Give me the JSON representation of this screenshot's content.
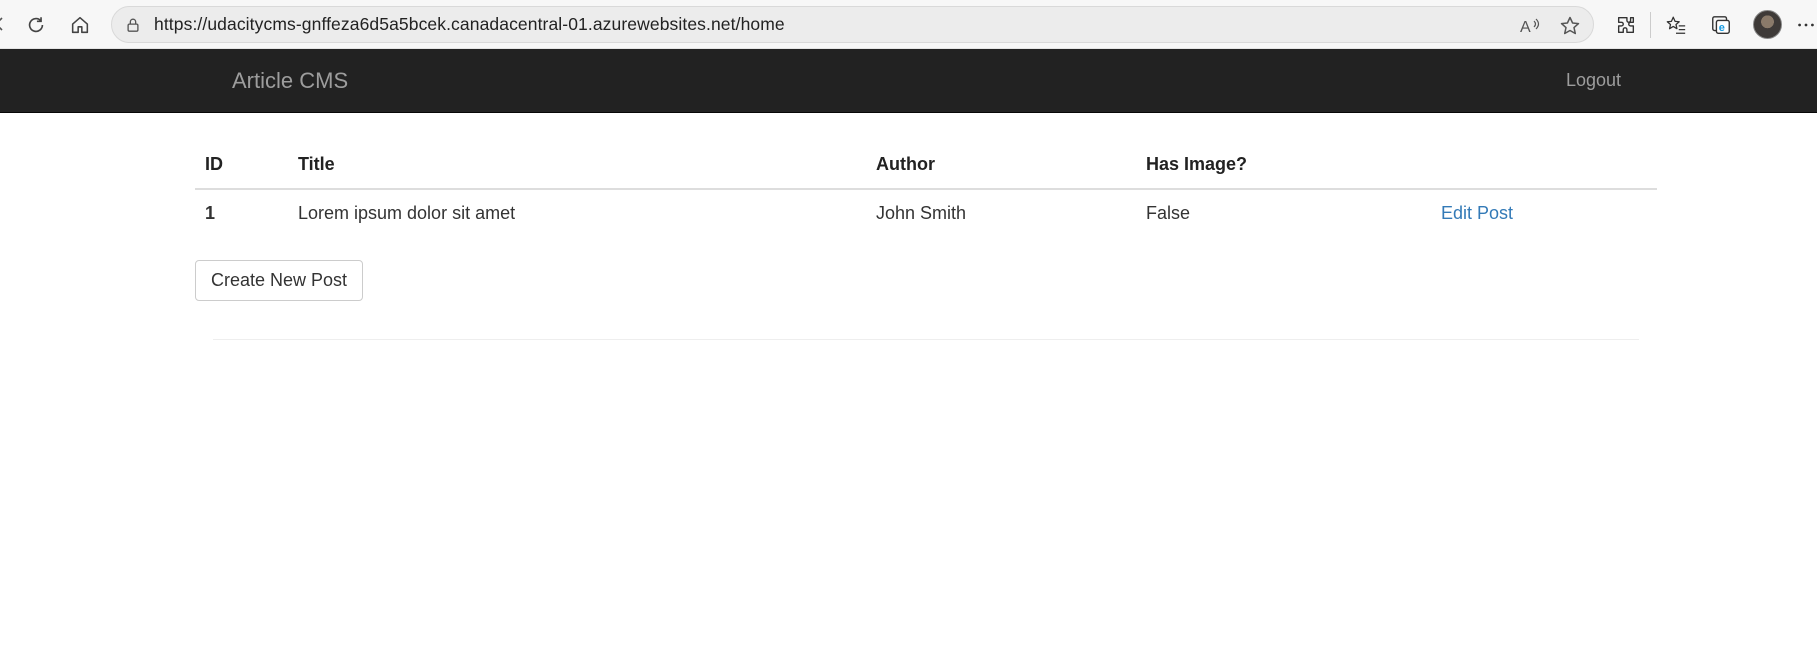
{
  "browser": {
    "url_host": "https://udacitycms-gnffeza6d5a5bcek.canadacentral-01.azurewebsites.net",
    "url_path": "/home",
    "icons": [
      "back-icon",
      "refresh-icon",
      "home-icon",
      "lock-icon",
      "read-aloud-icon",
      "favorite-star-icon",
      "extensions-icon",
      "favorites-icon",
      "collections-icon",
      "profile-avatar",
      "more-icon"
    ]
  },
  "navbar": {
    "brand": "Article CMS",
    "logout": "Logout",
    "background": "#222222",
    "text_color": "#9d9d9d"
  },
  "table": {
    "headers": [
      "ID",
      "Title",
      "Author",
      "Has Image?",
      ""
    ],
    "rows": [
      {
        "id": "1",
        "title": "Lorem ipsum dolor sit amet",
        "author": "John Smith",
        "has_image": "False",
        "action": "Edit Post"
      }
    ]
  },
  "actions": {
    "create_label": "Create New Post"
  },
  "colors": {
    "link": "#337ab7"
  }
}
